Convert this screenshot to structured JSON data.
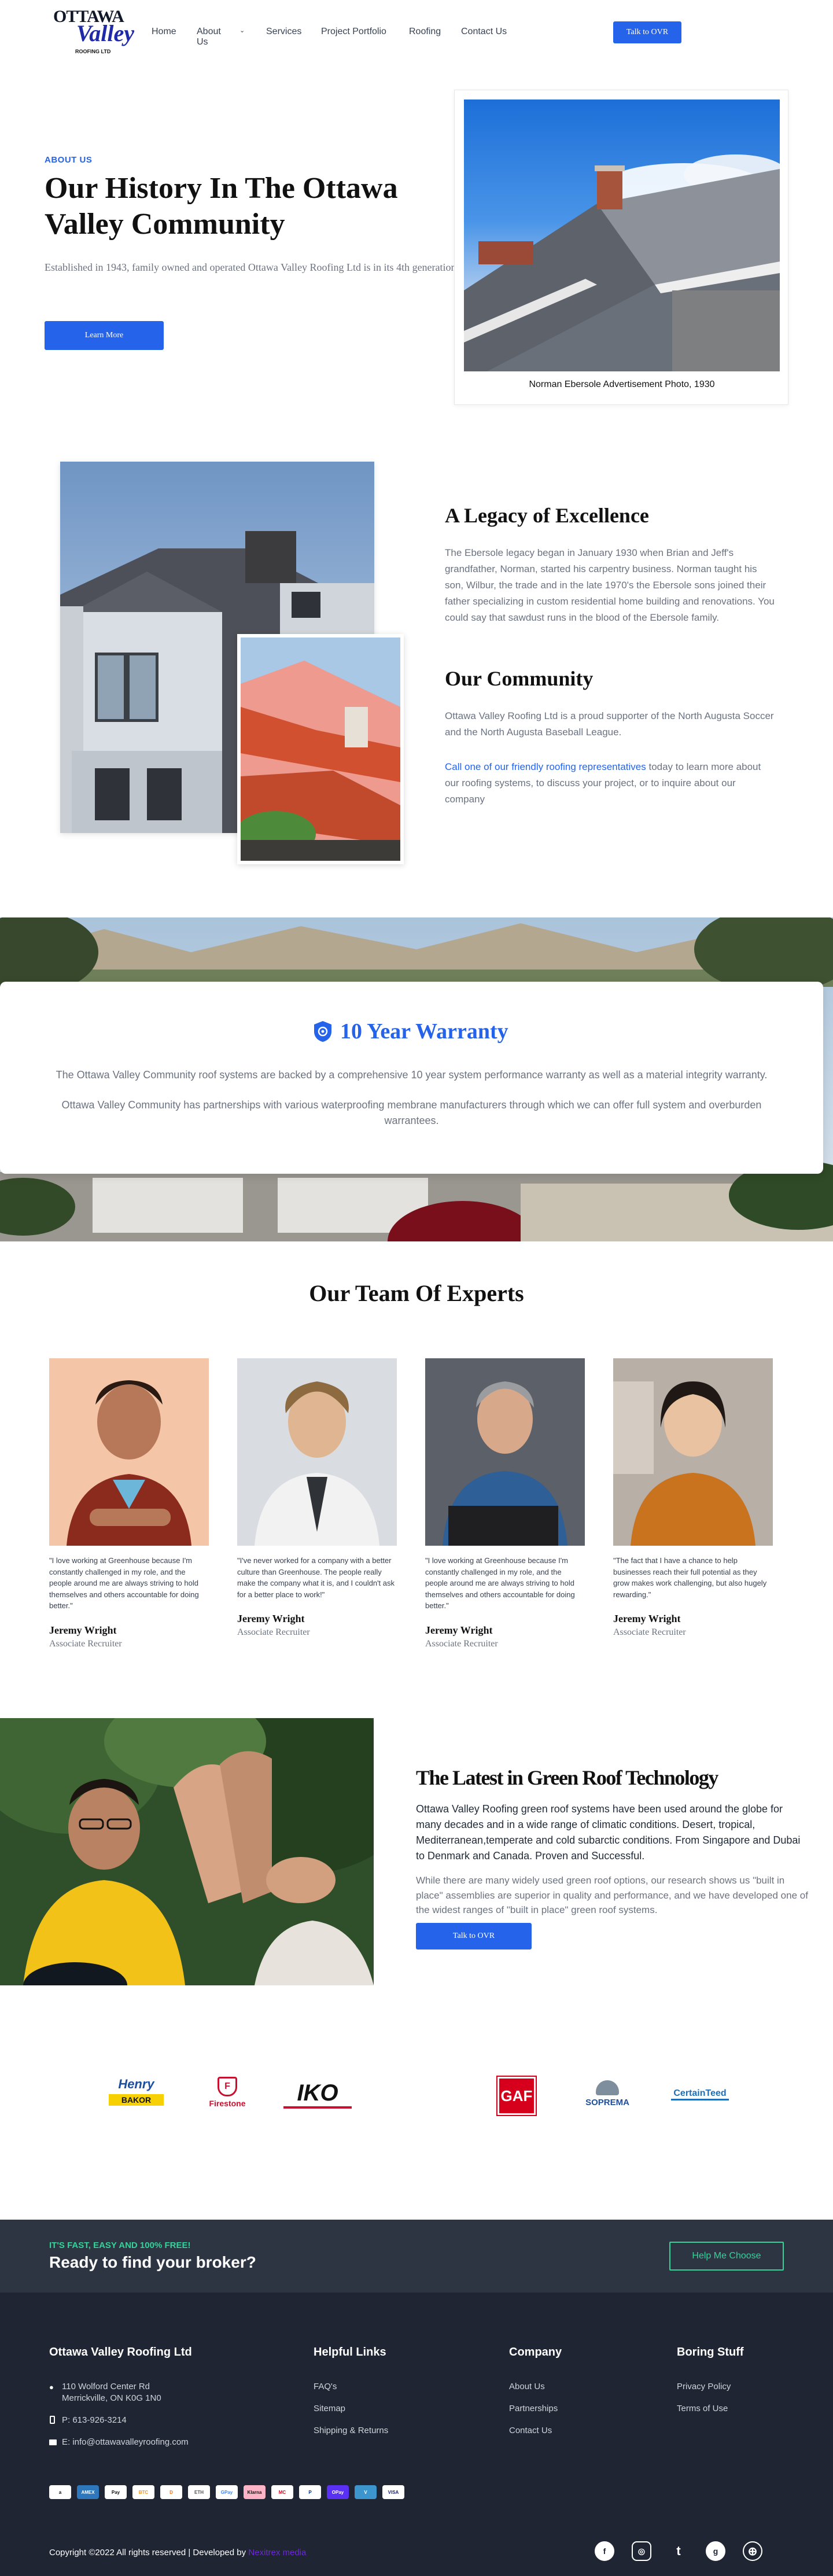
{
  "header": {
    "logo_top": "OTTAWA",
    "logo_script": "Valley",
    "logo_sub": "ROOFING LTD",
    "nav": [
      "Home",
      "About Us",
      "Services",
      "Project Portfolio",
      "Roofing",
      "Contact Us"
    ],
    "cta": "Talk to OVR"
  },
  "hero": {
    "eyebrow": "ABOUT US",
    "title": "Our History In The Ottawa Valley Community",
    "text": "Established in 1943, family owned and operated Ottawa Valley Roofing Ltd is in its 4th generation.",
    "button": "Learn More",
    "photo_caption": "Norman Ebersole Advertisement Photo, 1930"
  },
  "legacy": {
    "title": "A Legacy of Excellence",
    "text": "The Ebersole legacy began in January 1930 when Brian and Jeff's grandfather, Norman, started his carpentry business. Norman taught his son, Wilbur, the trade and in the late 1970's the Ebersole sons joined their father specializing in custom residential home building and renovations. You could say that sawdust runs in the blood of the Ebersole family.",
    "community_title": "Our Community",
    "community_text": "Ottawa Valley Roofing Ltd is a proud supporter of the North Augusta Soccer and the North Augusta Baseball League.",
    "call_link": "Call one of our friendly roofing representatives",
    "call_rest": " today to learn more about our roofing systems, to discuss your project, or to inquire about our company"
  },
  "warranty": {
    "title": "10 Year Warranty",
    "p1": "The Ottawa Valley Community roof systems are backed by a comprehensive 10 year system performance warranty as well as a material integrity warranty.",
    "p2": "Ottawa Valley Community has partnerships with various waterproofing membrane manufacturers through which we can offer full system and overburden warrantees."
  },
  "team": {
    "title": "Our Team Of Experts",
    "members": [
      {
        "quote": "\"I love working at Greenhouse because I'm constantly challenged in my role, and the people around me are always striving to hold themselves and others accountable for doing better.\"",
        "name": "Jeremy Wright",
        "role": "Associate Recruiter"
      },
      {
        "quote": "\"I've never worked for a company with a better culture than Greenhouse. The people really make the company what it is, and I couldn't ask for a better place to work!\"",
        "name": "Jeremy Wright",
        "role": "Associate Recruiter"
      },
      {
        "quote": "\"I love working at Greenhouse because I'm constantly challenged in my role, and the people around me are always striving to hold themselves and others accountable for doing better.\"",
        "name": "Jeremy Wright",
        "role": "Associate Recruiter"
      },
      {
        "quote": "\"The fact that I have a chance to help businesses reach their full potential as they grow makes work challenging, but also hugely rewarding.\"",
        "name": "Jeremy Wright",
        "role": "Associate Recruiter"
      }
    ]
  },
  "green": {
    "title": "The Latest in Green Roof Technology",
    "p1": "Ottawa Valley Roofing green roof systems have been used around the globe for many decades and in a wide range of climatic conditions. Desert, tropical, Mediterranean,temperate and cold subarctic conditions. From Singapore and Dubai to Denmark and Canada. Proven and Successful.",
    "p2": "While there are many widely used green roof options, our research shows us \"built in place\" assemblies are superior in quality and performance, and we have developed one of the widest ranges of \"built in place\" green roof systems.",
    "button": "Talk to OVR"
  },
  "partners": {
    "logos": [
      "Henry",
      "BAKOR",
      "Firestone",
      "IKO",
      "GAF",
      "SOPREMA",
      "CertainTeed"
    ]
  },
  "broker": {
    "eyebrow": "IT'S FAST, EASY AND 100% FREE!",
    "title": "Ready to find your broker?",
    "button": "Help Me Choose"
  },
  "footer": {
    "company_name": "Ottawa Valley Roofing Ltd",
    "address1": "110 Wolford Center Rd",
    "address2": "Merrickville, ON K0G 1N0",
    "phone": "P: 613-926-3214",
    "email": "E: info@ottawavalleyroofing.com",
    "col_helpful": {
      "title": "Helpful Links",
      "links": [
        "FAQ's",
        "Sitemap",
        "Shipping & Returns"
      ]
    },
    "col_company": {
      "title": "Company",
      "links": [
        "About Us",
        "Partnerships",
        "Contact Us"
      ]
    },
    "col_boring": {
      "title": "Boring Stuff",
      "links": [
        "Privacy Policy",
        "Terms of Use"
      ]
    },
    "payments": [
      "a",
      "AMEX",
      "Pay",
      "BTC",
      "D",
      "ETH",
      "GPay",
      "Klarna",
      "MC",
      "P",
      "OPay",
      "V",
      "VISA"
    ],
    "copyright": "Copyright ©2022 All rights reserved | Developed by",
    "dev_link": "Nexitrex media",
    "socials": [
      "f",
      "◎",
      "t",
      "g",
      "⊕"
    ]
  }
}
